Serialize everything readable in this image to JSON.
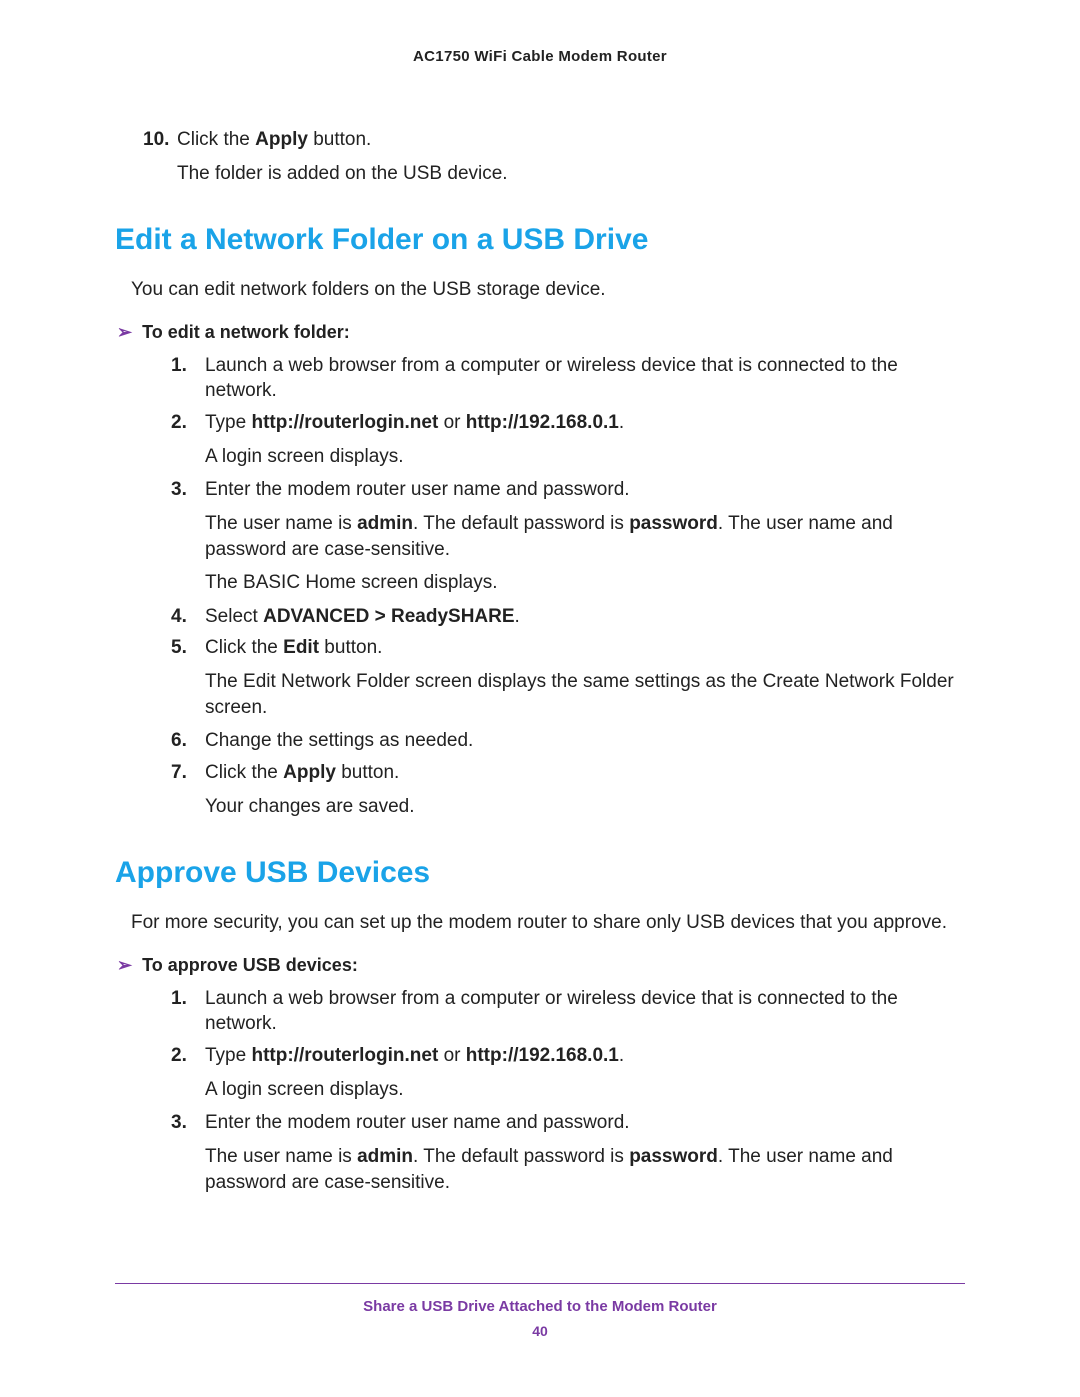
{
  "header": {
    "product": "AC1750 WiFi Cable Modem Router"
  },
  "intro": {
    "step10_num": "10.",
    "step10_a": "Click the ",
    "step10_b": "Apply",
    "step10_c": " button.",
    "step10_result": "The folder is added on the USB device."
  },
  "section1": {
    "title": "Edit a Network Folder on a USB Drive",
    "intro": "You can edit network folders on the USB storage device.",
    "task": "To edit a network folder:",
    "steps": {
      "s1_num": "1.",
      "s1": "Launch a web browser from a computer or wireless device that is connected to the network.",
      "s2_num": "2.",
      "s2_a": "Type ",
      "s2_b": "http://routerlogin.net",
      "s2_c": " or ",
      "s2_d": "http://192.168.0.1",
      "s2_e": ".",
      "s2_result": "A login screen displays.",
      "s3_num": "3.",
      "s3": "Enter the modem router user name and password.",
      "s3_r1_a": "The user name is ",
      "s3_r1_b": "admin",
      "s3_r1_c": ". The default password is ",
      "s3_r1_d": "password",
      "s3_r1_e": ". The user name and password are case-sensitive.",
      "s3_r2": "The BASIC Home screen displays.",
      "s4_num": "4.",
      "s4_a": "Select ",
      "s4_b": "ADVANCED > ReadySHARE",
      "s4_c": ".",
      "s5_num": "5.",
      "s5_a": "Click the ",
      "s5_b": "Edit",
      "s5_c": " button.",
      "s5_result": "The Edit Network Folder screen displays the same settings as the Create Network Folder screen.",
      "s6_num": "6.",
      "s6": "Change the settings as needed.",
      "s7_num": "7.",
      "s7_a": "Click the ",
      "s7_b": "Apply",
      "s7_c": " button.",
      "s7_result": "Your changes are saved."
    }
  },
  "section2": {
    "title": "Approve USB Devices",
    "intro": "For more security, you can set up the modem router to share only USB devices that you approve.",
    "task": "To approve USB devices:",
    "steps": {
      "s1_num": "1.",
      "s1": "Launch a web browser from a computer or wireless device that is connected to the network.",
      "s2_num": "2.",
      "s2_a": "Type ",
      "s2_b": "http://routerlogin.net",
      "s2_c": " or ",
      "s2_d": "http://192.168.0.1",
      "s2_e": ".",
      "s2_result": "A login screen displays.",
      "s3_num": "3.",
      "s3": "Enter the modem router user name and password.",
      "s3_r1_a": "The user name is ",
      "s3_r1_b": "admin",
      "s3_r1_c": ". The default password is ",
      "s3_r1_d": "password",
      "s3_r1_e": ". The user name and password are case-sensitive."
    }
  },
  "footer": {
    "chapter": "Share a USB Drive Attached to the Modem Router",
    "page": "40"
  },
  "glyph": {
    "task_arrow": "➢"
  }
}
